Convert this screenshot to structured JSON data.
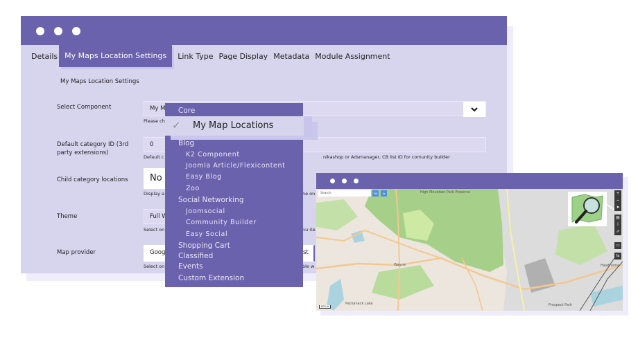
{
  "window": {
    "tabs": [
      {
        "label": "Details",
        "active": false
      },
      {
        "label": "My Maps Location Settings",
        "active": true
      },
      {
        "label": "Link Type",
        "active": false
      },
      {
        "label": "Page Display",
        "active": false
      },
      {
        "label": "Metadata",
        "active": false
      },
      {
        "label": "Module Assignment",
        "active": false
      }
    ],
    "section_title": "My Maps Location Settings",
    "fields": {
      "select_component": {
        "label": "Select Component",
        "value": "My M",
        "help": "Please ch"
      },
      "default_category": {
        "label": "Default category ID (3rd party extensions)",
        "value": "0",
        "help_left": "Default c",
        "help_right": "nikashop or Adsmanager, CB list ID for comunity builder"
      },
      "child_category": {
        "label": "Child category locations",
        "value": "No",
        "help_left": "Display a",
        "help_right": "he on"
      },
      "theme": {
        "label": "Theme",
        "value": "Full W",
        "help_left": "Select on",
        "help_right": "nu ite"
      },
      "map_provider": {
        "label": "Map provider",
        "value": "Googl",
        "value_right": "st",
        "help_left": "Select on",
        "help_right": "able w"
      }
    }
  },
  "dropdown": {
    "selected": "My Map Locations",
    "items": [
      {
        "label": "Core",
        "type": "group"
      },
      {
        "label": "Blog",
        "type": "group"
      },
      {
        "label": "K2 Component",
        "type": "sub"
      },
      {
        "label": "Joomla Article/Flexicontent",
        "type": "sub"
      },
      {
        "label": "Easy Blog",
        "type": "sub"
      },
      {
        "label": "Zoo",
        "type": "sub"
      },
      {
        "label": "Social Networking",
        "type": "group"
      },
      {
        "label": "Joomsocial",
        "type": "sub"
      },
      {
        "label": "Community Builder",
        "type": "sub"
      },
      {
        "label": "Easy Social",
        "type": "sub"
      },
      {
        "label": "Shopping Cart",
        "type": "group"
      },
      {
        "label": "Classified",
        "type": "group"
      },
      {
        "label": "Events",
        "type": "group"
      },
      {
        "label": "Custom Extension",
        "type": "group"
      }
    ]
  },
  "map": {
    "search_placeholder": "Search",
    "go_label": "Go",
    "scale": "800 m",
    "labels": [
      "High Mountain Park Preserve",
      "Wayne",
      "Hawthorne",
      "Prospect Park",
      "Packanack Lake"
    ],
    "controls": [
      "+",
      "−",
      "➤",
      "▤",
      "i",
      "⇗",
      "▭",
      "⇆"
    ]
  },
  "colors": {
    "accent": "#6a62ad",
    "panel": "#d7d4ee",
    "shadow": "#efedfc"
  }
}
